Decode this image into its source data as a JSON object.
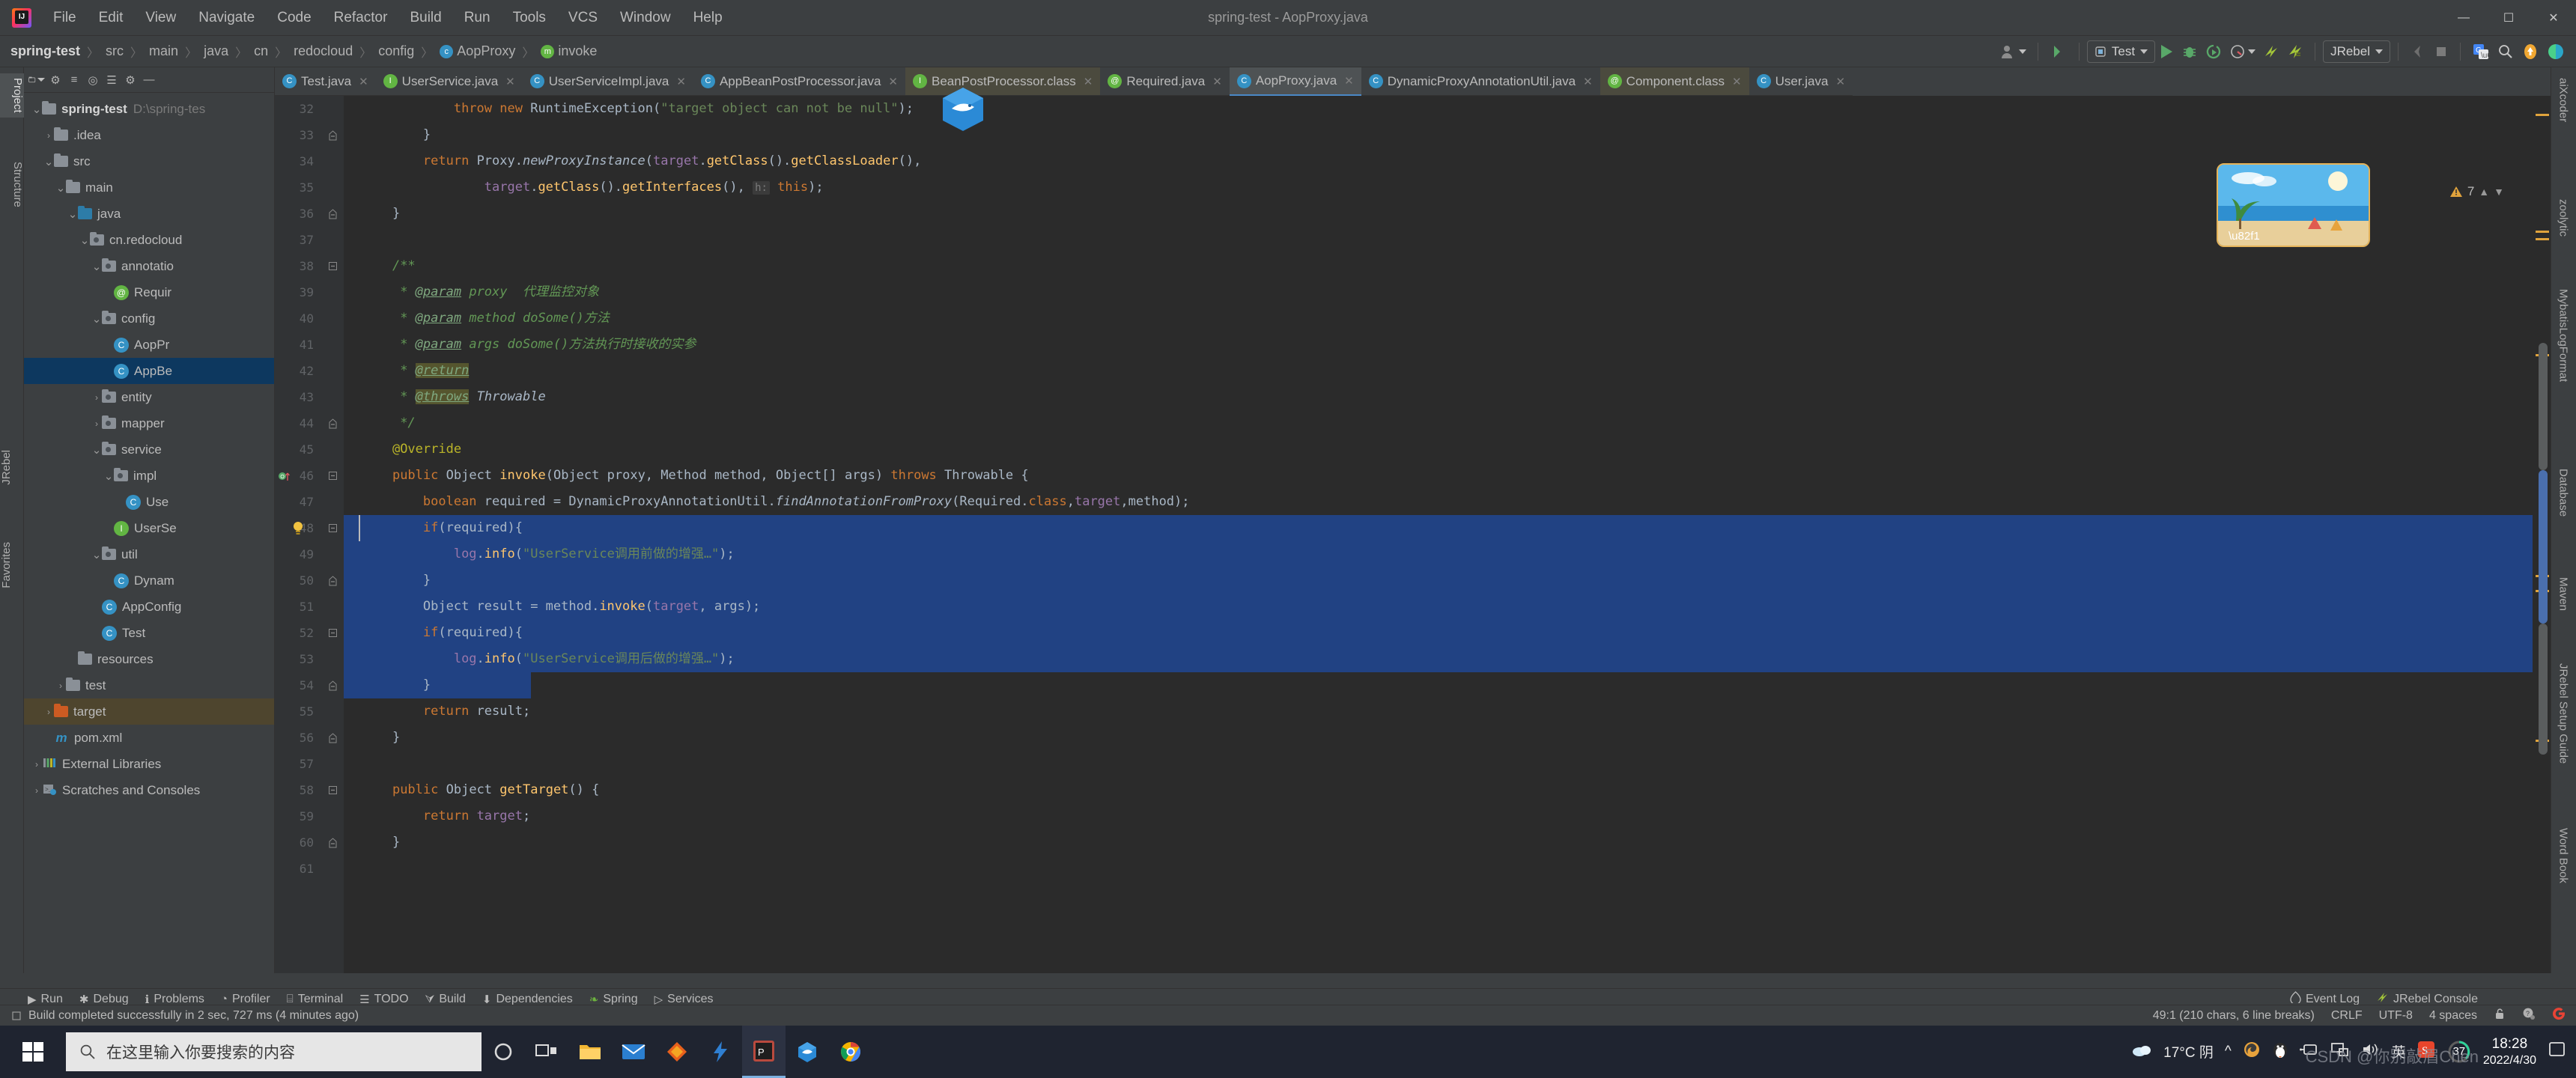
{
  "window": {
    "title": "spring-test - AopProxy.java",
    "minimize": "—",
    "maximize": "☐",
    "close": "✕"
  },
  "menu": [
    "File",
    "Edit",
    "View",
    "Navigate",
    "Code",
    "Refactor",
    "Build",
    "Run",
    "Tools",
    "VCS",
    "Window",
    "Help"
  ],
  "navbar": {
    "crumbs": [
      "spring-test",
      "src",
      "main",
      "java",
      "cn",
      "redocloud",
      "config",
      "AopProxy",
      "invoke"
    ],
    "separator": "〉",
    "run_config": "Test",
    "jrebel": "JRebel",
    "icons": [
      "profile-icon",
      "build-icon",
      "run-icon",
      "debug-icon",
      "run-coverage-icon",
      "profile-run-icon",
      "jrebel-run-icon",
      "jrebel-debug-icon",
      "stop-icon",
      "translate-icon",
      "search-everywhere-icon",
      "update-icon",
      "settings-icon"
    ]
  },
  "left_stripe": [
    {
      "label": "Project",
      "selected": true
    },
    {
      "label": "Structure",
      "selected": false
    },
    {
      "label": "JRebel",
      "selected": false
    },
    {
      "label": "Favorites",
      "selected": false
    }
  ],
  "right_stripe": [
    {
      "label": "aiXcoder",
      "icon": "aix-icon"
    },
    {
      "label": "zoolytic",
      "icon": ""
    },
    {
      "label": "MybatisLogFormat",
      "icon": ""
    },
    {
      "label": "Database",
      "icon": "database-icon"
    },
    {
      "label": "Maven",
      "icon": "maven-icon"
    },
    {
      "label": "JRebel Setup Guide",
      "icon": "jrebel-icon"
    },
    {
      "label": "Word Book",
      "icon": "book-icon"
    }
  ],
  "project_panel": {
    "title": "Project",
    "toolbar_icons": [
      "project-view-select",
      "collapse-all",
      "expand-all",
      "locate-file",
      "settings",
      "hide"
    ],
    "tree": [
      {
        "indent": 0,
        "arrow": "v",
        "icon": "module",
        "label": "spring-test",
        "bold": true,
        "path": "D:\\spring-tes",
        "state": "normal"
      },
      {
        "indent": 1,
        "arrow": ">",
        "icon": "folder",
        "label": ".idea",
        "state": "normal"
      },
      {
        "indent": 1,
        "arrow": "v",
        "icon": "folder",
        "label": "src",
        "state": "normal"
      },
      {
        "indent": 2,
        "arrow": "v",
        "icon": "folder",
        "label": "main",
        "state": "normal"
      },
      {
        "indent": 3,
        "arrow": "v",
        "icon": "folder-src",
        "label": "java",
        "state": "normal"
      },
      {
        "indent": 4,
        "arrow": "v",
        "icon": "package",
        "label": "cn.redocloud",
        "state": "normal"
      },
      {
        "indent": 5,
        "arrow": "v",
        "icon": "package",
        "label": "annotatio",
        "state": "normal"
      },
      {
        "indent": 6,
        "arrow": "",
        "icon": "annotation",
        "label": "Requir",
        "state": "normal"
      },
      {
        "indent": 5,
        "arrow": "v",
        "icon": "package",
        "label": "config",
        "state": "normal"
      },
      {
        "indent": 6,
        "arrow": "",
        "icon": "class",
        "label": "AopPr",
        "state": "normal"
      },
      {
        "indent": 6,
        "arrow": "",
        "icon": "class",
        "label": "AppBe",
        "state": "selected"
      },
      {
        "indent": 5,
        "arrow": ">",
        "icon": "package",
        "label": "entity",
        "state": "normal"
      },
      {
        "indent": 5,
        "arrow": ">",
        "icon": "package",
        "label": "mapper",
        "state": "normal"
      },
      {
        "indent": 5,
        "arrow": "v",
        "icon": "package",
        "label": "service",
        "state": "normal"
      },
      {
        "indent": 6,
        "arrow": "v",
        "icon": "package",
        "label": "impl",
        "state": "normal"
      },
      {
        "indent": 7,
        "arrow": "",
        "icon": "class",
        "label": "Use",
        "state": "normal"
      },
      {
        "indent": 6,
        "arrow": "",
        "icon": "interface",
        "label": "UserSe",
        "state": "normal"
      },
      {
        "indent": 5,
        "arrow": "v",
        "icon": "package",
        "label": "util",
        "state": "normal"
      },
      {
        "indent": 6,
        "arrow": "",
        "icon": "class",
        "label": "Dynam",
        "state": "normal"
      },
      {
        "indent": 5,
        "arrow": "",
        "icon": "class",
        "label": "AppConfig",
        "state": "normal"
      },
      {
        "indent": 5,
        "arrow": "",
        "icon": "class-run",
        "label": "Test",
        "state": "normal"
      },
      {
        "indent": 3,
        "arrow": "",
        "icon": "folder-res",
        "label": "resources",
        "state": "normal"
      },
      {
        "indent": 2,
        "arrow": ">",
        "icon": "folder",
        "label": "test",
        "state": "normal"
      },
      {
        "indent": 1,
        "arrow": ">",
        "icon": "folder-target",
        "label": "target",
        "state": "highlight"
      },
      {
        "indent": 1,
        "arrow": "",
        "icon": "maven",
        "label": "pom.xml",
        "state": "normal"
      },
      {
        "indent": 0,
        "arrow": ">",
        "icon": "libs",
        "label": "External Libraries",
        "state": "normal"
      },
      {
        "indent": 0,
        "arrow": ">",
        "icon": "scratches",
        "label": "Scratches and Consoles",
        "state": "normal"
      }
    ]
  },
  "editor": {
    "tabs": [
      {
        "label": "Test.java",
        "icon": "class-run-icon",
        "kind": "c",
        "active": false
      },
      {
        "label": "UserService.java",
        "icon": "interface-icon",
        "kind": "i",
        "active": false
      },
      {
        "label": "UserServiceImpl.java",
        "icon": "class-icon",
        "kind": "c",
        "active": false
      },
      {
        "label": "AppBeanPostProcessor.java",
        "icon": "class-icon",
        "kind": "c",
        "active": false
      },
      {
        "label": "BeanPostProcessor.class",
        "icon": "interface-lib-icon",
        "kind": "i",
        "active": false,
        "library": true
      },
      {
        "label": "Required.java",
        "icon": "annotation-icon",
        "kind": "a",
        "active": false
      },
      {
        "label": "AopProxy.java",
        "icon": "class-icon",
        "kind": "c",
        "active": true
      },
      {
        "label": "DynamicProxyAnnotationUtil.java",
        "icon": "class-icon",
        "kind": "c",
        "active": false
      },
      {
        "label": "Component.class",
        "icon": "annotation-lib-icon",
        "kind": "a",
        "active": false,
        "library": true
      },
      {
        "label": "User.java",
        "icon": "class-icon",
        "kind": "c",
        "active": false
      }
    ],
    "first_line_number": 32,
    "warning_count": "7",
    "lines": [
      {
        "num": 32,
        "html": "            <span class=\"k\">throw new</span> <span class=\"ty\">RuntimeException</span>(<span class=\"s\">\"target object can not be null\"</span>);",
        "fold": "",
        "hl": false
      },
      {
        "num": 33,
        "html": "        }",
        "fold": "end",
        "hl": false
      },
      {
        "num": 34,
        "html": "        <span class=\"k\">return</span> <span class=\"ty\">Proxy</span>.<span class=\"st\">newProxyInstance</span>(<span class=\"n\">target</span>.<span class=\"m\">getClass</span>().<span class=\"m\">getClassLoader</span>(),",
        "fold": "",
        "hl": false
      },
      {
        "num": 35,
        "html": "                <span class=\"n\">target</span>.<span class=\"m\">getClass</span>().<span class=\"m\">getInterfaces</span>(), <span class=\"hint\">h:</span> <span class=\"k\">this</span>);",
        "fold": "",
        "hl": false
      },
      {
        "num": 36,
        "html": "    }",
        "fold": "end",
        "hl": false
      },
      {
        "num": 37,
        "html": "",
        "fold": "",
        "hl": false
      },
      {
        "num": 38,
        "html": "    <span class=\"cm\">/**</span>",
        "fold": "start",
        "hl": false
      },
      {
        "num": 39,
        "html": "     <span class=\"cm\">* </span><span class=\"tg\">@param</span><span class=\"cm\"> proxy  代理监控对象</span>",
        "fold": "",
        "hl": false
      },
      {
        "num": 40,
        "html": "     <span class=\"cm\">* </span><span class=\"tg\">@param</span><span class=\"cm\"> method doSome()方法</span>",
        "fold": "",
        "hl": false
      },
      {
        "num": 41,
        "html": "     <span class=\"cm\">* </span><span class=\"tg\">@param</span><span class=\"cm\"> args doSome()方法执行时接收的实参</span>",
        "fold": "",
        "hl": false
      },
      {
        "num": 42,
        "html": "     <span class=\"cm\">* </span><span class=\"tg selbg\">@return</span>",
        "fold": "",
        "hl": false
      },
      {
        "num": 43,
        "html": "     <span class=\"cm\">* </span><span class=\"tg selbg\">@throws</span><span class=\"cm\"> </span><span class=\"st\">Throwable</span>",
        "fold": "",
        "hl": false
      },
      {
        "num": 44,
        "html": "     <span class=\"cm\">*/</span>",
        "fold": "end",
        "hl": false
      },
      {
        "num": 45,
        "html": "    <span class=\"an\">@Override</span>",
        "fold": "",
        "hl": false
      },
      {
        "num": 46,
        "html": "    <span class=\"k\">public</span> <span class=\"ty\">Object</span> <span class=\"m\">invoke</span>(<span class=\"ty\">Object</span> proxy, <span class=\"ty\">Method</span> method, <span class=\"ty\">Object</span>[] args) <span class=\"k\">throws</span> <span class=\"ty\">Throwable</span> {",
        "fold": "start2",
        "hl": false,
        "gutter_marker": "override"
      },
      {
        "num": 47,
        "html": "        <span class=\"k\">boolean</span> required = <span class=\"ty\">DynamicProxyAnnotationUtil</span>.<span class=\"st\">findAnnotationFromProxy</span>(<span class=\"ty\">Required</span>.<span class=\"k\">class</span>,<span class=\"n\">target</span>,method);",
        "fold": "",
        "hl": false
      },
      {
        "num": 48,
        "html": "        <span class=\"k\">if</span>(required){",
        "fold": "start",
        "hl": true,
        "bulb": true
      },
      {
        "num": 49,
        "html": "            <span class=\"n\">log</span>.<span class=\"m\">info</span>(<span class=\"s\">\"UserService调用前做的增强…\"</span>);",
        "fold": "",
        "hl": true
      },
      {
        "num": 50,
        "html": "        }",
        "fold": "end",
        "hl": true
      },
      {
        "num": 51,
        "html": "        <span class=\"ty\">Object</span> result = method.<span class=\"m\">invoke</span>(<span class=\"n\">target</span>, args);",
        "fold": "",
        "hl": true
      },
      {
        "num": 52,
        "html": "        <span class=\"k\">if</span>(required){",
        "fold": "start",
        "hl": true
      },
      {
        "num": 53,
        "html": "            <span class=\"n\">log</span>.<span class=\"m\">info</span>(<span class=\"s\">\"UserService调用后做的增强…\"</span>);",
        "fold": "",
        "hl": true
      },
      {
        "num": 54,
        "html": "        }",
        "fold": "end",
        "hl": true,
        "partial": true
      },
      {
        "num": 55,
        "html": "        <span class=\"k\">return</span> result;",
        "fold": "",
        "hl": false
      },
      {
        "num": 56,
        "html": "    }",
        "fold": "end",
        "hl": false
      },
      {
        "num": 57,
        "html": "",
        "fold": "",
        "hl": false
      },
      {
        "num": 58,
        "html": "    <span class=\"k\">public</span> <span class=\"ty\">Object</span> <span class=\"m\">getTarget</span>() {",
        "fold": "start",
        "hl": false
      },
      {
        "num": 59,
        "html": "        <span class=\"k\">return</span> <span class=\"n\">target</span>;",
        "fold": "",
        "hl": false
      },
      {
        "num": 60,
        "html": "    }",
        "fold": "end",
        "hl": false
      },
      {
        "num": 61,
        "html": "",
        "fold": "",
        "hl": false
      }
    ]
  },
  "tool_windows": [
    {
      "label": "Run",
      "icon": "run-icon"
    },
    {
      "label": "Debug",
      "icon": "debug-icon"
    },
    {
      "label": "Problems",
      "icon": "problems-icon"
    },
    {
      "label": "Profiler",
      "icon": "profiler-icon"
    },
    {
      "label": "Terminal",
      "icon": "terminal-icon"
    },
    {
      "label": "TODO",
      "icon": "todo-icon"
    },
    {
      "label": "Build",
      "icon": "build-icon"
    },
    {
      "label": "Dependencies",
      "icon": "dependencies-icon"
    },
    {
      "label": "Spring",
      "icon": "spring-icon"
    },
    {
      "label": "Services",
      "icon": "services-icon"
    }
  ],
  "tool_windows_right": [
    {
      "label": "Event Log",
      "icon": "event-log-icon"
    },
    {
      "label": "JRebel Console",
      "icon": "jrebel-icon"
    }
  ],
  "status_bar": {
    "message": "Build completed successfully in 2 sec, 727 ms (4 minutes ago)",
    "caret": "49:1 (210 chars, 6 line breaks)",
    "line_sep": "CRLF",
    "encoding": "UTF-8",
    "indent": "4 spaces",
    "icons": [
      "lock-icon",
      "inspection-icon",
      "google-icon"
    ]
  },
  "taskbar": {
    "search_placeholder": "在这里输入你要搜索的内容",
    "start_icon": "windows-start-icon",
    "icons": [
      "cortana-icon",
      "task-view-icon",
      "file-explorer-icon",
      "mail-icon",
      "store-icon",
      "flash-icon",
      "pycharm-icon",
      "idea-icon",
      "chrome-icon"
    ],
    "weather": "17°C 阴",
    "tray": [
      "firefox-icon",
      "qq-icon",
      "usb-icon",
      "network-icon",
      "volume-icon"
    ],
    "ime": "英",
    "sogou": "S",
    "battery": "37",
    "time": "18:28",
    "date": "2022/4/30",
    "watermark": "CSDN @你别敲眉Chen"
  }
}
